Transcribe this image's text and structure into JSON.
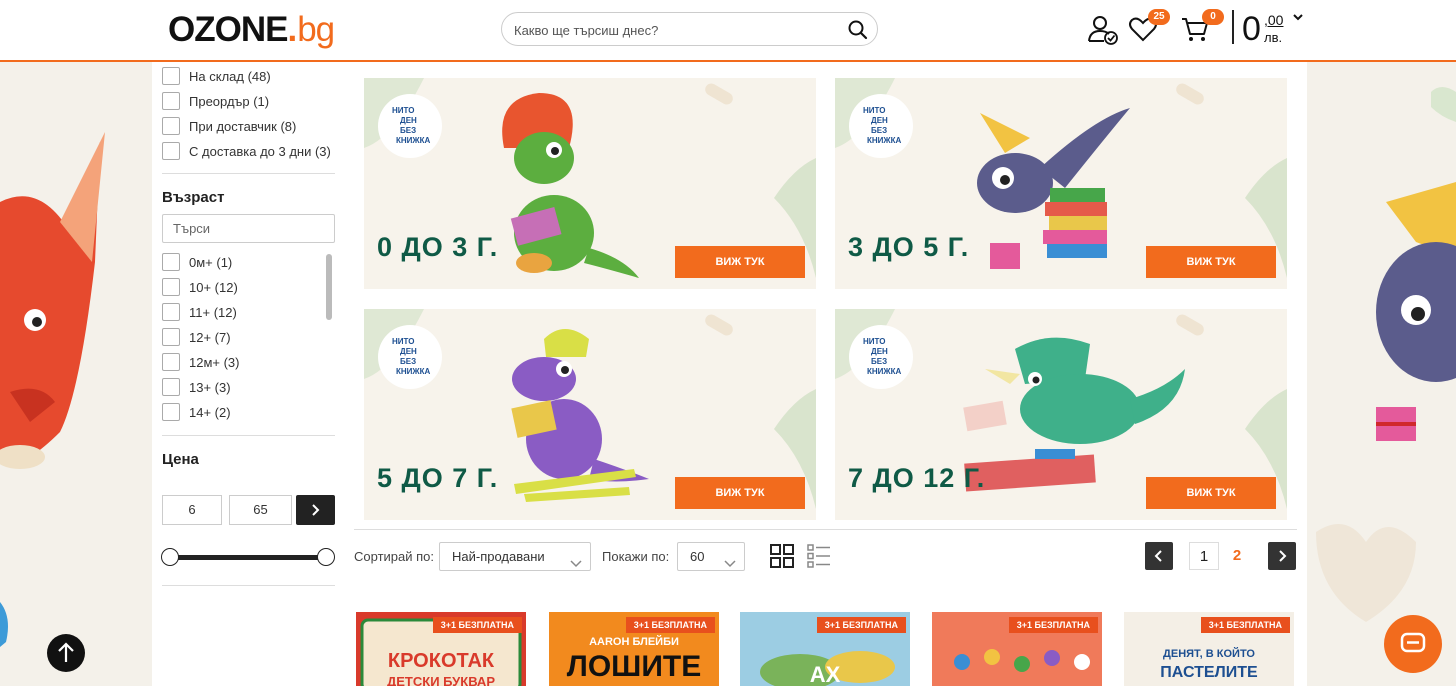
{
  "header": {
    "logo_main": "OZONE",
    "logo_dot": ".",
    "logo_tld": "bg",
    "search_placeholder": "Какво ще търсиш днес?",
    "wishlist_count": "25",
    "cart_count": "0",
    "price_int": "0",
    "price_dec": ",00",
    "price_currency": "лв."
  },
  "sidebar": {
    "availability": [
      {
        "label": "На склад (48)"
      },
      {
        "label": "Преордър (1)"
      },
      {
        "label": "При доставчик (8)"
      },
      {
        "label": "С доставка до 3 дни (3)"
      }
    ],
    "age_title": "Възраст",
    "age_search_placeholder": "Търси",
    "ages": [
      {
        "label": "0м+ (1)"
      },
      {
        "label": "10+ (12)"
      },
      {
        "label": "11+ (12)"
      },
      {
        "label": "12+ (7)"
      },
      {
        "label": "12м+ (3)"
      },
      {
        "label": "13+ (3)"
      },
      {
        "label": "14+ (2)"
      }
    ],
    "price_title": "Цена",
    "price_min": "6",
    "price_max": "65"
  },
  "banners": [
    {
      "age": "0 ДО 3 Г.",
      "button": "ВИЖ ТУК",
      "brand": [
        "НИТО",
        "ДЕН",
        "БЕЗ",
        "КНИЖКА"
      ]
    },
    {
      "age": "3 ДО 5 Г.",
      "button": "ВИЖ ТУК",
      "brand": [
        "НИТО",
        "ДЕН",
        "БЕЗ",
        "КНИЖКА"
      ]
    },
    {
      "age": "5 ДО 7 Г.",
      "button": "ВИЖ ТУК",
      "brand": [
        "НИТО",
        "ДЕН",
        "БЕЗ",
        "КНИЖКА"
      ]
    },
    {
      "age": "7 ДО 12 Г.",
      "button": "ВИЖ ТУК",
      "brand": [
        "НИТО",
        "ДЕН",
        "БЕЗ",
        "КНИЖКА"
      ]
    }
  ],
  "toolbar": {
    "sort_label": "Сортирай по:",
    "sort_value": "Най-продавани",
    "show_label": "Покажи по:",
    "show_value": "60",
    "pages": [
      "1",
      "2"
    ]
  },
  "products": [
    {
      "promo": "3+1 БЕЗПЛАТНА",
      "cover_text": "КРОКОТАК",
      "cover_sub": "ДЕТСКИ БУКВАР",
      "cover_color": "#d93a2b"
    },
    {
      "promo": "3+1 БЕЗПЛАТНА",
      "cover_text": "ЛОШИТЕ",
      "cover_sub": "АARОН БЛЕЙБИ",
      "cover_color": "#f28a1e"
    },
    {
      "promo": "3+1 БЕЗПЛАТНА",
      "cover_text": "АХ",
      "cover_sub": "",
      "cover_color": "#9ccde3"
    },
    {
      "promo": "3+1 БЕЗПЛАТНА",
      "cover_text": "",
      "cover_sub": "",
      "cover_color": "#f07a5a"
    },
    {
      "promo": "3+1 БЕЗПЛАТНА",
      "cover_text": "ПАСТЕЛИТЕ",
      "cover_sub": "ДЕНЯТ, В КОЙТО",
      "cover_color": "#f4efe6"
    }
  ]
}
